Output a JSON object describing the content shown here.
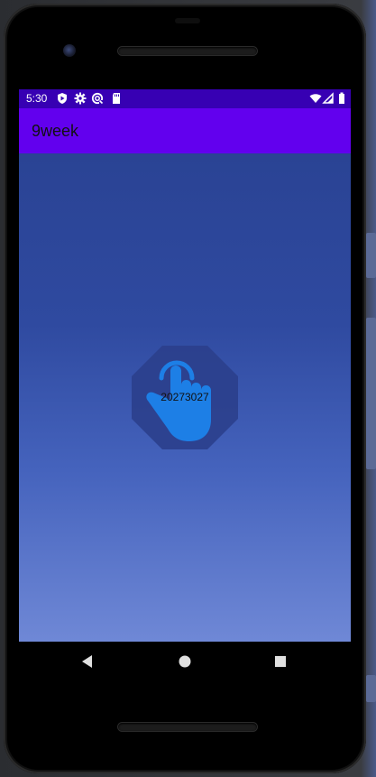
{
  "status_bar": {
    "time": "5:30",
    "icons_left": [
      "play-protect-icon",
      "settings-icon",
      "sync-icon",
      "sd-card-icon"
    ],
    "icons_right": [
      "wifi-icon",
      "signal-icon",
      "battery-icon"
    ],
    "color": "#3700b3"
  },
  "app_bar": {
    "title": "9week",
    "color": "#6200ee"
  },
  "main": {
    "touch_button": {
      "label": "20273027",
      "icon": "touch-hand-icon",
      "icon_color": "#1d7fe6"
    },
    "gradient_top": "#2a4394",
    "gradient_bottom": "#6f88d6"
  },
  "nav_bar": {
    "buttons": [
      "back-icon",
      "home-icon",
      "recents-icon"
    ]
  }
}
